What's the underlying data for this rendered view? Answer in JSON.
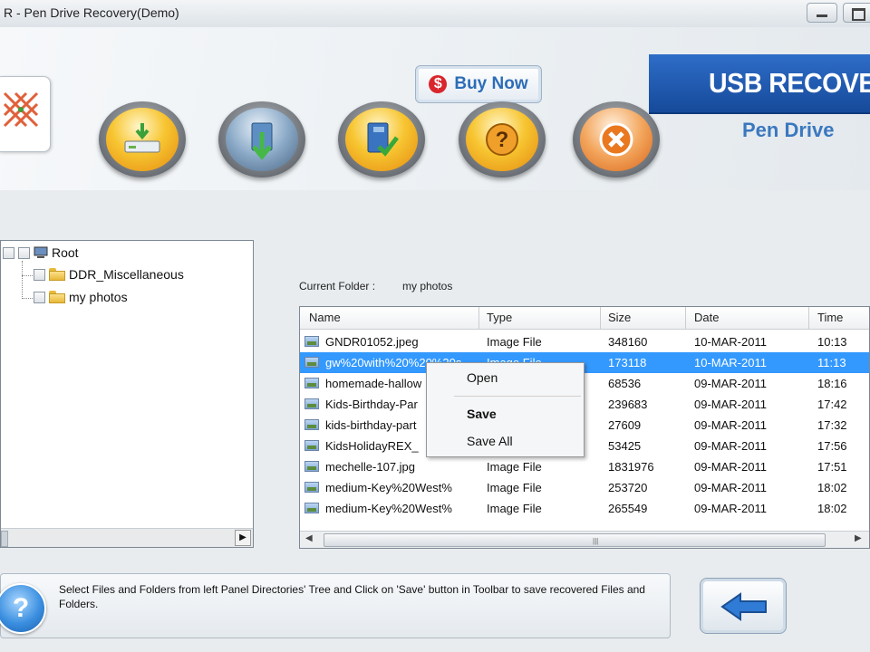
{
  "window": {
    "title": "R - Pen Drive Recovery(Demo)"
  },
  "header": {
    "buy_now_symbol": "$",
    "buy_now_label": "Buy Now",
    "brand_title": "USB RECOVERY",
    "brand_subtitle": "Pen Drive",
    "brand_color": "#1f5bb0",
    "toolbar_icons": [
      "drive-open-icon",
      "drive-scan-icon",
      "save-book-icon",
      "help-icon",
      "exit-icon"
    ]
  },
  "tree": {
    "root": "Root",
    "children": [
      "DDR_Miscellaneous",
      "my photos"
    ]
  },
  "current_folder": {
    "label": "Current Folder  :",
    "value": "my photos"
  },
  "filelist": {
    "columns": [
      "Name",
      "Type",
      "Size",
      "Date",
      "Time"
    ],
    "rows": [
      {
        "name": "GNDR01052.jpeg",
        "type": "Image File",
        "size": "348160",
        "date": "10-MAR-2011",
        "time": "10:13"
      },
      {
        "name": "gw%20with%20%20%20s",
        "type": "Image File",
        "size": "173118",
        "date": "10-MAR-2011",
        "time": "11:13"
      },
      {
        "name": "homemade-hallow",
        "type": "",
        "size": "68536",
        "date": "09-MAR-2011",
        "time": "18:16"
      },
      {
        "name": "Kids-Birthday-Par",
        "type": "",
        "size": "239683",
        "date": "09-MAR-2011",
        "time": "17:42"
      },
      {
        "name": "kids-birthday-part",
        "type": "",
        "size": "27609",
        "date": "09-MAR-2011",
        "time": "17:32"
      },
      {
        "name": "KidsHolidayREX_",
        "type": "",
        "size": "53425",
        "date": "09-MAR-2011",
        "time": "17:56"
      },
      {
        "name": "mechelle-107.jpg",
        "type": "Image File",
        "size": "1831976",
        "date": "09-MAR-2011",
        "time": "17:51"
      },
      {
        "name": "medium-Key%20West%",
        "type": "Image File",
        "size": "253720",
        "date": "09-MAR-2011",
        "time": "18:02"
      },
      {
        "name": "medium-Key%20West%",
        "type": "Image File",
        "size": "265549",
        "date": "09-MAR-2011",
        "time": "18:02"
      }
    ],
    "selected_row": 1
  },
  "context_menu": {
    "open": "Open",
    "save": "Save",
    "save_all": "Save All"
  },
  "status": {
    "help_symbol": "?",
    "text": "Select Files and Folders from left Panel Directories' Tree and Click on 'Save' button in Toolbar to save recovered Files and Folders."
  }
}
